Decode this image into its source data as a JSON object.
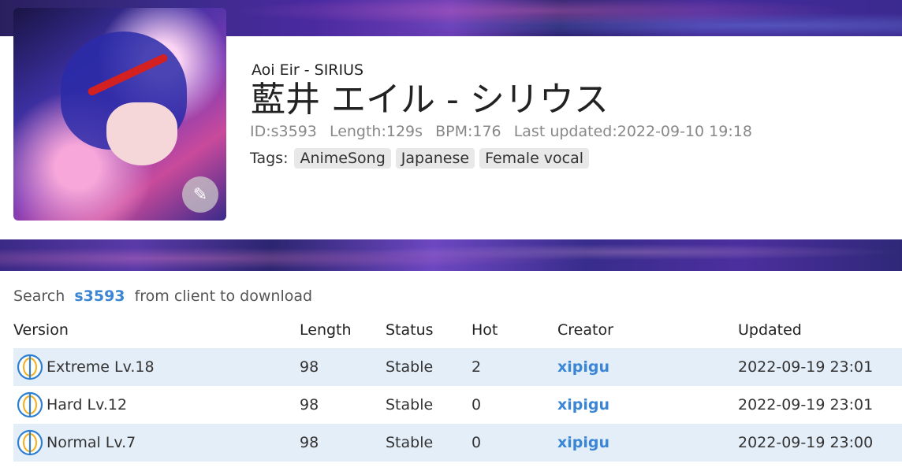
{
  "song": {
    "subtitle": "Aoi Eir - SIRIUS",
    "title": "藍井 エイル - シリウス",
    "meta": {
      "id": "ID:s3593",
      "length": "Length:129s",
      "bpm": "BPM:176",
      "updated": "Last updated:2022-09-10 19:18"
    },
    "tags_label": "Tags:",
    "tags": [
      "AnimeSong",
      "Japanese",
      "Female vocal"
    ]
  },
  "search": {
    "prefix": "Search",
    "sid": "s3593",
    "suffix": "from client to download"
  },
  "table": {
    "headers": {
      "version": "Version",
      "length": "Length",
      "status": "Status",
      "hot": "Hot",
      "creator": "Creator",
      "updated": "Updated"
    },
    "rows": [
      {
        "version": "Extreme Lv.18",
        "length": "98",
        "status": "Stable",
        "hot": "2",
        "creator": "xipigu",
        "updated": "2022-09-19 23:01"
      },
      {
        "version": "Hard Lv.12",
        "length": "98",
        "status": "Stable",
        "hot": "0",
        "creator": "xipigu",
        "updated": "2022-09-19 23:01"
      },
      {
        "version": "Normal Lv.7",
        "length": "98",
        "status": "Stable",
        "hot": "0",
        "creator": "xipigu",
        "updated": "2022-09-19 23:00"
      }
    ]
  },
  "colors": {
    "link": "#3a86d4",
    "row_highlight": "#e4eef9"
  },
  "icons": {
    "edit": "pencil-icon",
    "mode": "mode-icon"
  }
}
